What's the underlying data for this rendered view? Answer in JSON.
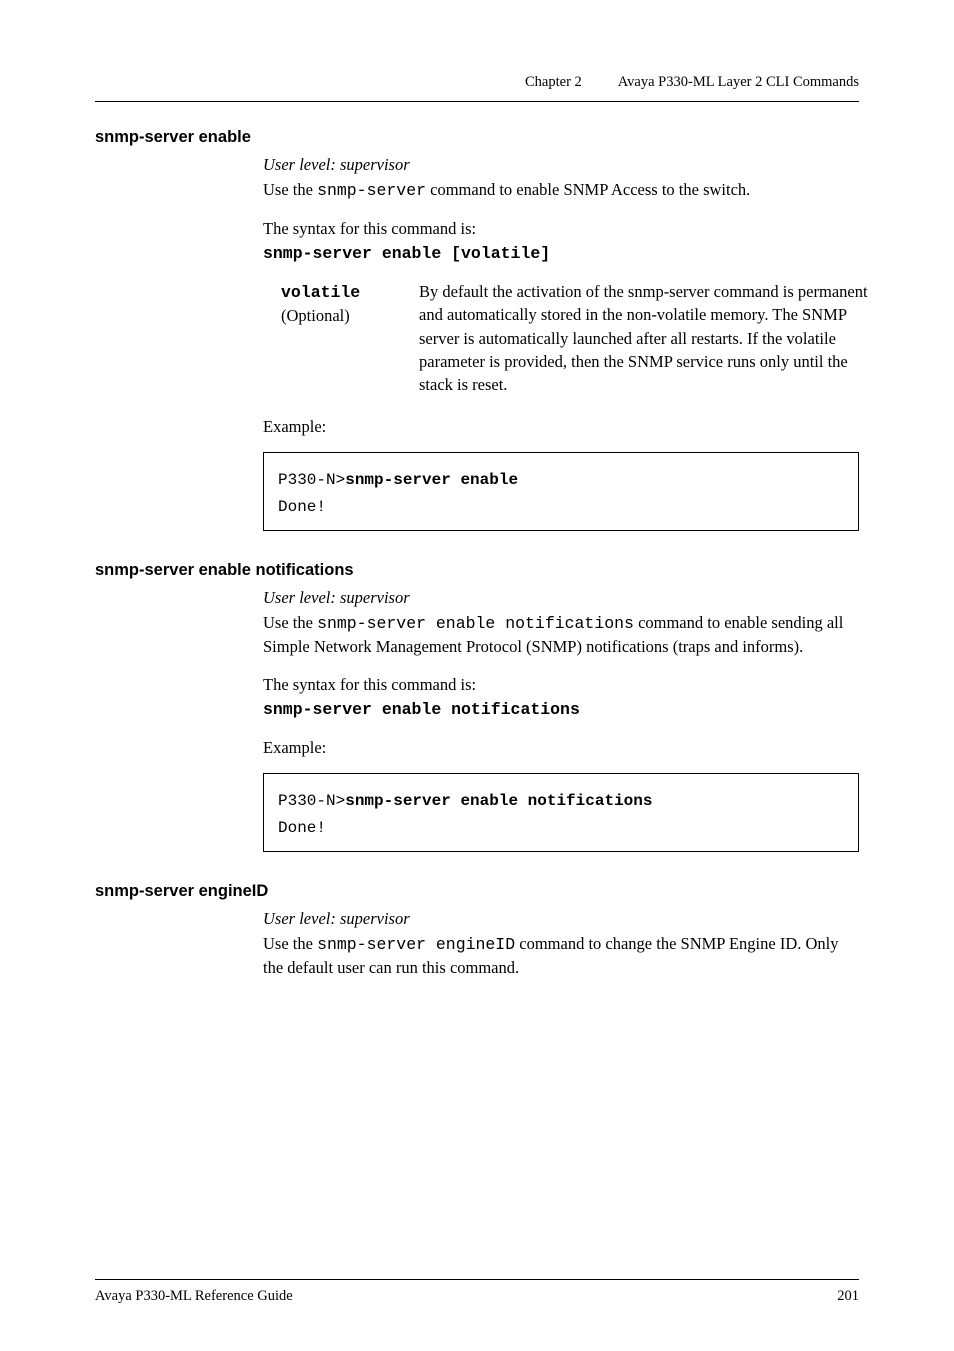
{
  "header": {
    "chapter": "Chapter 2",
    "title": "Avaya P330-ML Layer 2 CLI Commands"
  },
  "sections": [
    {
      "title": "snmp-server enable",
      "user_level": "User level: supervisor",
      "intro_prefix": "Use the ",
      "intro_code": "snmp-server",
      "intro_suffix": " command to enable SNMP Access to the switch.",
      "syntax_label": "The syntax for this command is:",
      "syntax_cmd": "snmp-server enable [volatile]",
      "param_key_mono": "volatile",
      "param_key_plain": "(Optional)",
      "param_desc": "By default the activation of the snmp-server command is permanent and automatically stored in the non-volatile memory. The SNMP server is automatically launched after all restarts. If the volatile parameter is provided, then the SNMP service runs only until the stack is reset.",
      "example_label": "Example:",
      "code_prompt": "P330-N>",
      "code_cmd": "snmp-server enable",
      "code_output": "Done!"
    },
    {
      "title": "snmp-server enable notifications",
      "user_level": "User level: supervisor",
      "intro_prefix": "Use the ",
      "intro_code": "snmp-server enable notifications",
      "intro_suffix": " command to enable sending all Simple Network Management Protocol (SNMP) notifications  (traps and informs).",
      "syntax_label": "The syntax for this command is:",
      "syntax_cmd": "snmp-server enable notifications",
      "example_label": "Example:",
      "code_prompt": "P330-N>",
      "code_cmd": "snmp-server enable notifications",
      "code_output": "Done!"
    },
    {
      "title": "snmp-server engineID",
      "user_level": "User level: supervisor",
      "intro_prefix": "Use the ",
      "intro_code": "snmp-server engineID",
      "intro_suffix": " command to change the SNMP Engine ID. Only the default user can run this command."
    }
  ],
  "footer": {
    "guide": "Avaya P330-ML Reference Guide",
    "page": "201"
  }
}
